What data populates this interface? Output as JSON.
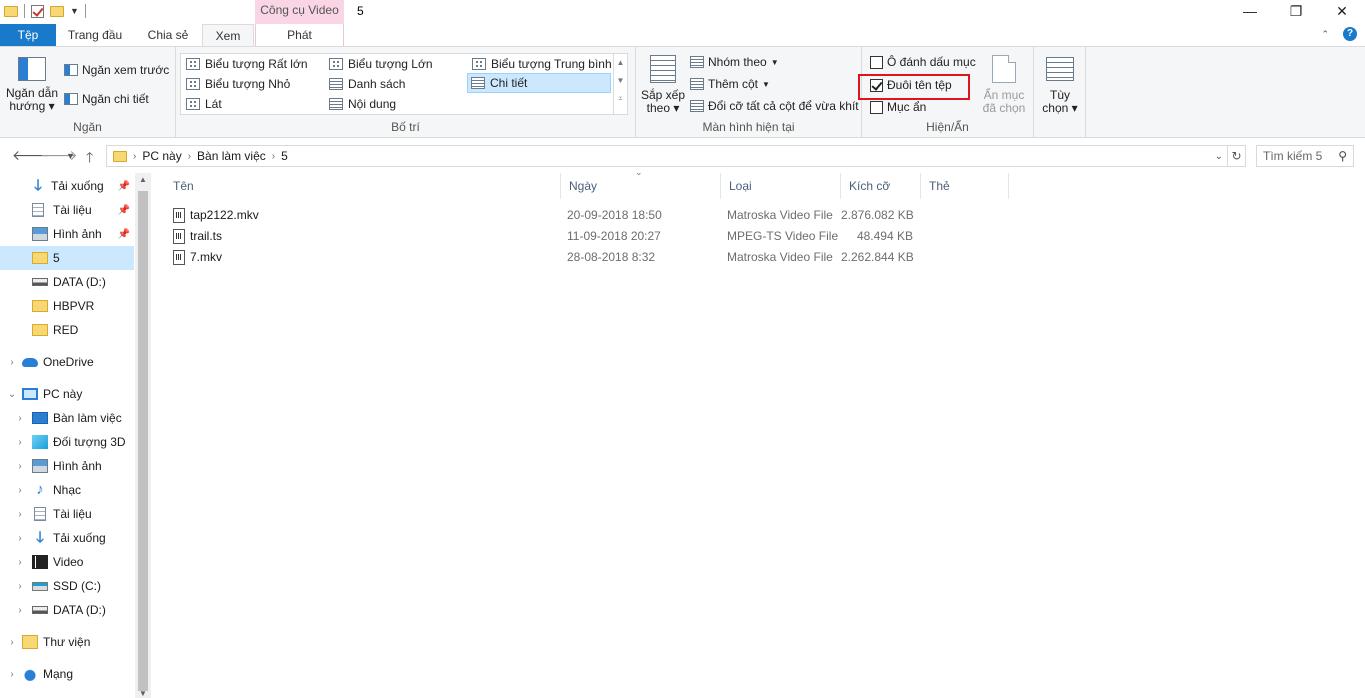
{
  "window": {
    "title": "5",
    "contextual_tab_header": "Công cụ Video",
    "minimize_glyph": "—",
    "restore_glyph": "❐",
    "close_glyph": "✕"
  },
  "tabs": [
    {
      "label": "Tệp"
    },
    {
      "label": "Trang đầu"
    },
    {
      "label": "Chia sẻ"
    },
    {
      "label": "Xem"
    },
    {
      "label": "Phát"
    }
  ],
  "ribbon": {
    "pane_group": {
      "label": "Ngăn",
      "nav_pane": "Ngăn dẫn",
      "nav_pane_2": "hướng",
      "preview_pane": "Ngăn xem trước",
      "details_pane": "Ngăn chi tiết"
    },
    "layout_group": {
      "label": "Bố trí",
      "items": [
        "Biểu tượng Rất lớn",
        "Biểu tượng Lớn",
        "Biểu tượng Trung bình",
        "Biểu tượng Nhỏ",
        "Danh sách",
        "Chi tiết",
        "Lát",
        "Nội dung"
      ]
    },
    "view_group": {
      "label": "Màn hình hiện tại",
      "sort_by": "Sắp xếp",
      "sort_by_2": "theo",
      "group_by": "Nhóm theo",
      "add_columns": "Thêm cột",
      "size_all_columns": "Đổi cỡ tất cả cột để vừa khít"
    },
    "showhide_group": {
      "label": "Hiện/Ẩn",
      "item_checkboxes": "Ô đánh dấu mục",
      "file_extensions": "Đuôi tên tệp",
      "hidden_items": "Mục ẩn",
      "hide_selected": "Ẩn mục",
      "hide_selected_2": "đã chọn"
    },
    "options": {
      "label": "Tùy",
      "label_2": "chọn"
    }
  },
  "address": {
    "crumbs": [
      "PC này",
      "Bàn làm việc",
      "5"
    ],
    "search_placeholder": "Tìm kiếm 5"
  },
  "nav_pane": {
    "quick_access": [
      {
        "label": "Tải xuống",
        "icon": "download-icon"
      },
      {
        "label": "Tài liệu",
        "icon": "document-icon"
      },
      {
        "label": "Hình ảnh",
        "icon": "pictures-icon"
      },
      {
        "label": "5",
        "icon": "folder-icon"
      },
      {
        "label": "DATA (D:)",
        "icon": "drive-icon"
      },
      {
        "label": "HBPVR",
        "icon": "folder-icon"
      },
      {
        "label": "RED",
        "icon": "folder-icon"
      }
    ],
    "onedrive": "OneDrive",
    "this_pc": "PC này",
    "pc_items": [
      {
        "label": "Bàn làm việc",
        "icon": "desktop-icon"
      },
      {
        "label": "Đối tượng 3D",
        "icon": "3d-objects-icon"
      },
      {
        "label": "Hình ảnh",
        "icon": "pictures-icon"
      },
      {
        "label": "Nhạc",
        "icon": "music-icon"
      },
      {
        "label": "Tài liệu",
        "icon": "document-icon"
      },
      {
        "label": "Tải xuống",
        "icon": "download-icon"
      },
      {
        "label": "Video",
        "icon": "video-icon"
      },
      {
        "label": "SSD (C:)",
        "icon": "ssd-icon"
      },
      {
        "label": "DATA (D:)",
        "icon": "drive-icon"
      }
    ],
    "libraries": "Thư viện",
    "network": "Mạng"
  },
  "file_list": {
    "columns": [
      "Tên",
      "Ngày",
      "Loại",
      "Kích cỡ",
      "Thẻ"
    ],
    "files": [
      {
        "name": "tap2122.mkv",
        "date": "20-09-2018 18:50",
        "type": "Matroska Video File",
        "size": "2.876.082 KB"
      },
      {
        "name": "trail.ts",
        "date": "11-09-2018 20:27",
        "type": "MPEG-TS Video File",
        "size": "48.494 KB"
      },
      {
        "name": "7.mkv",
        "date": "28-08-2018 8:32",
        "type": "Matroska Video File",
        "size": "2.262.844 KB"
      }
    ]
  },
  "colors": {
    "accent": "#1979ca",
    "contextual_tab": "#f9d5e5",
    "selection": "#cce8ff",
    "highlight_box": "#e0141e"
  }
}
